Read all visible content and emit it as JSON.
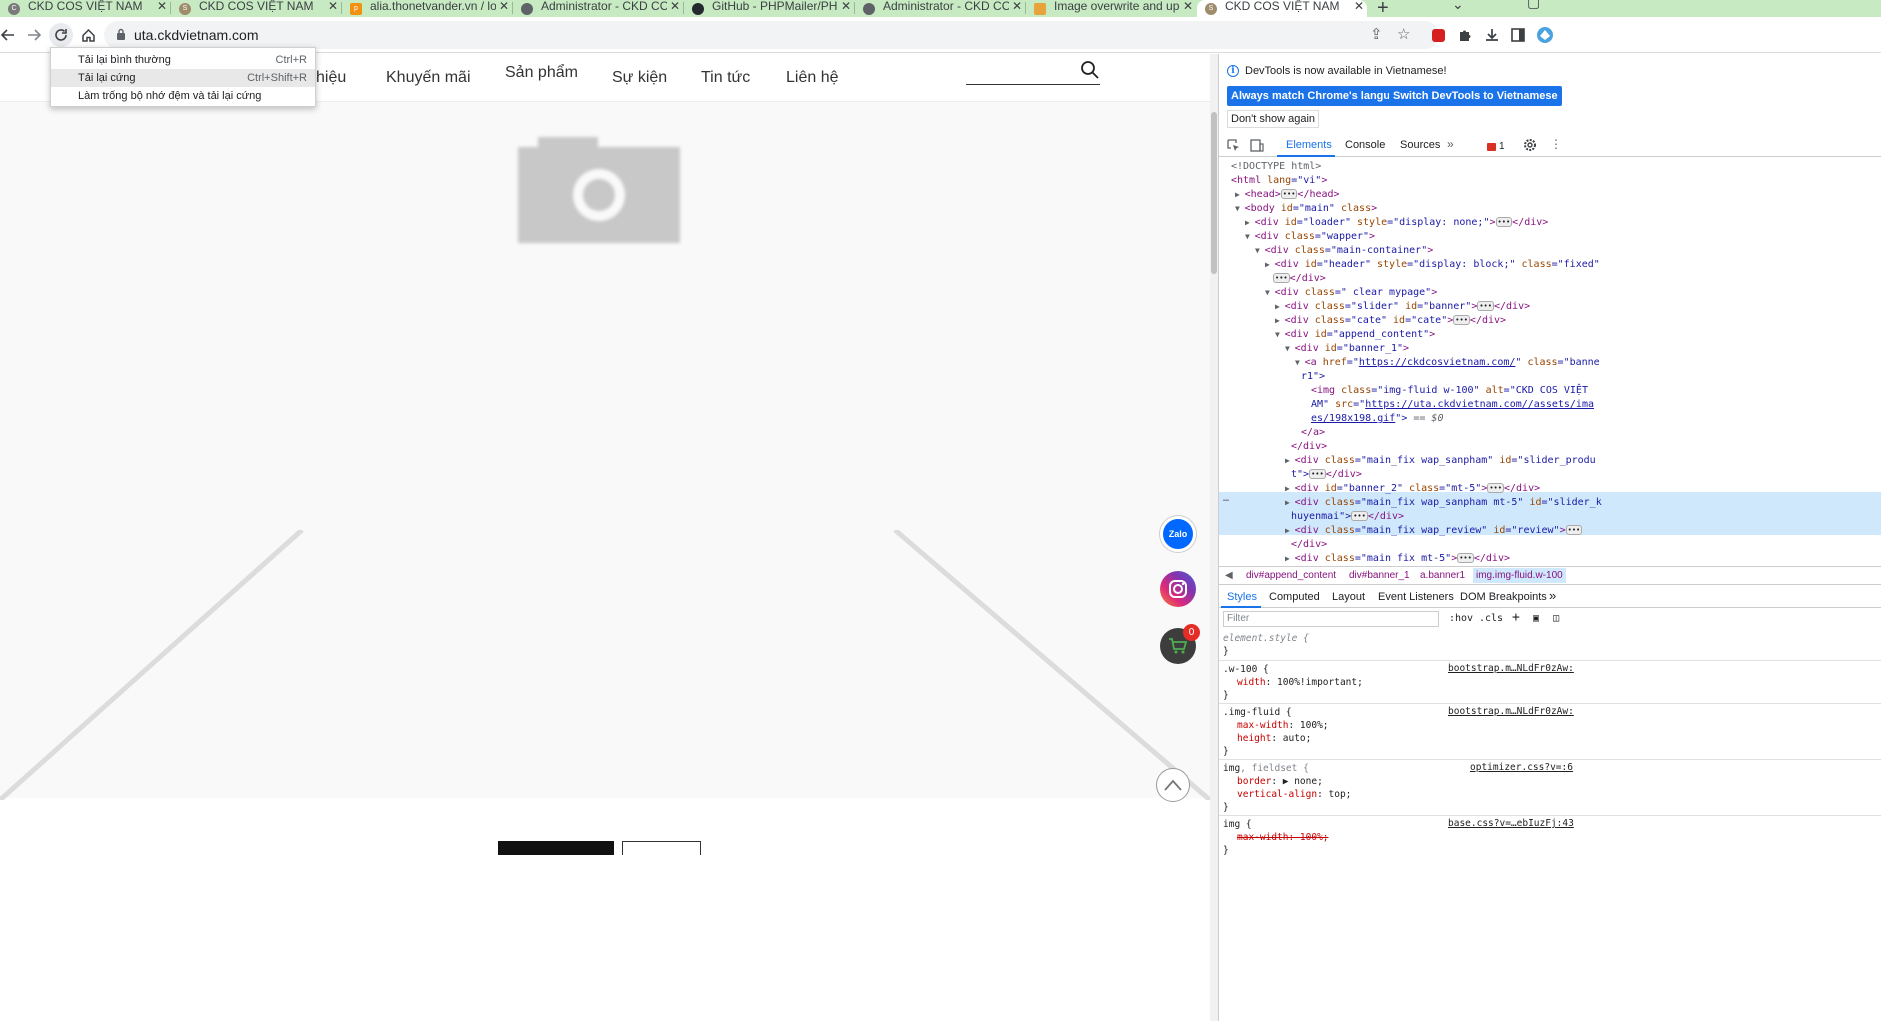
{
  "browser": {
    "tabs": [
      {
        "title": "CKD COS VIỆT NAM",
        "favicon_color": "#7a7a7a"
      },
      {
        "title": "CKD COS VIỆT NAM",
        "favicon_color": "#9e8c6a"
      },
      {
        "title": "alia.thonetvander.vn / loc",
        "favicon_color": "#f29111"
      },
      {
        "title": "Administrator - CKD COS",
        "favicon_color": "#5f6368"
      },
      {
        "title": "GitHub - PHPMailer/PHPI",
        "favicon_color": "#24292f"
      },
      {
        "title": "Administrator - CKD COS",
        "favicon_color": "#5f6368"
      },
      {
        "title": "Image overwrite and upd",
        "favicon_color": "#e8a33d"
      },
      {
        "title": "CKD COS VIỆT NAM",
        "favicon_color": "#9e8c6a"
      }
    ],
    "tab_close": "✕",
    "new_tab": "+",
    "url": "uta.ckdvietnam.com"
  },
  "reload_menu": {
    "items": [
      {
        "label": "Tải lại bình thường",
        "shortcut": "Ctrl+R"
      },
      {
        "label": "Tải lại cứng",
        "shortcut": "Ctrl+Shift+R"
      },
      {
        "label": "Làm trống bộ nhớ đệm và tải lại cứng",
        "shortcut": ""
      }
    ]
  },
  "site": {
    "nav": [
      "hiệu",
      "Khuyến mãi",
      "Sản phẩm",
      "Sự kiện",
      "Tin tức",
      "Liên hệ"
    ],
    "zalo_label": "Zalo",
    "cart_count": "0"
  },
  "devtools": {
    "info_text": "DevTools is now available in Vietnamese!",
    "btn_match": "Always match Chrome's language",
    "btn_switch": "Switch DevTools to Vietnamese",
    "btn_dont": "Don't show again",
    "tabs": [
      "Elements",
      "Console",
      "Sources"
    ],
    "error_count": "1",
    "breadcrumbs": [
      "div#append_content",
      "div#banner_1",
      "a.banner1",
      "img.img-fluid.w-100"
    ],
    "styles_tabs": [
      "Styles",
      "Computed",
      "Layout",
      "Event Listeners",
      "DOM Breakpoints"
    ],
    "filter_placeholder": "Filter",
    "hov": ":hov",
    "cls": ".cls",
    "dom_lines": {
      "l1": "<!DOCTYPE html>",
      "l2a": "<html ",
      "l2b": "lang",
      "l2c": "=\"vi\"",
      "l2d": ">",
      "l3": "<head>",
      "l3b": "</head>",
      "l4a": "<body ",
      "l4b": "id",
      "l4c": "=\"main\" ",
      "l4d": "class",
      "l4e": ">",
      "l5a": "<div ",
      "l5b": "id",
      "l5c": "=\"loader\" ",
      "l5d": "style",
      "l5e": "=\"display: none;\"",
      "l5f": ">",
      "l5g": "</div>",
      "l6a": "<div ",
      "l6b": "class",
      "l6c": "=\"wapper\"",
      "l6d": ">",
      "l7a": "<div ",
      "l7b": "class",
      "l7c": "=\"main-container\"",
      "l7d": ">",
      "l8a": "<div ",
      "l8b": "id",
      "l8c": "=\"header\" ",
      "l8d": "style",
      "l8e": "=\"display: block;\" ",
      "l8f": "class",
      "l8g": "=\"fixed\"",
      "l9": "</div>",
      "l10a": "<div ",
      "l10b": "class",
      "l10c": "=\" clear mypage\"",
      "l10d": ">",
      "l11a": "<div ",
      "l11b": "class",
      "l11c": "=\"slider\" ",
      "l11d": "id",
      "l11e": "=\"banner\"",
      "l11f": ">",
      "l11g": "</div>",
      "l12a": "<div ",
      "l12b": "class",
      "l12c": "=\"cate\" ",
      "l12d": "id",
      "l12e": "=\"cate\"",
      "l12f": ">",
      "l12g": "</div>",
      "l13a": "<div ",
      "l13b": "id",
      "l13c": "=\"append_content\"",
      "l13d": ">",
      "l14a": "<div ",
      "l14b": "id",
      "l14c": "=\"banner_1\"",
      "l14d": ">",
      "l15a": "<a ",
      "l15b": "href",
      "l15c": "=\"",
      "l15d": "https://ckdcosvietnam.com/",
      "l15e": "\" ",
      "l15f": "class",
      "l15g": "=\"banne",
      "l16": "r1\">",
      "l17a": "<img ",
      "l17b": "class",
      "l17c": "=\"img-fluid w-100\" ",
      "l17d": "alt",
      "l17e": "=\"CKD COS VIỆT",
      "l18a": "AM\" ",
      "l18b": "src",
      "l18c": "=\"",
      "l18d": "https://uta.ckdvietnam.com//assets/ima",
      "l19a": "es/198x198.gif",
      "l19b": "\">",
      "l19c": " == $0",
      "l20": "</a>",
      "l21": "</div>",
      "l22a": "<div ",
      "l22b": "class",
      "l22c": "=\"main_fix wap_sanpham\" ",
      "l22d": "id",
      "l22e": "=\"slider_produ",
      "l23a": "t\">",
      "l23b": "</div>",
      "l24a": "<div ",
      "l24b": "id",
      "l24c": "=\"banner_2\" ",
      "l24d": "class",
      "l24e": "=\"mt-5\"",
      "l24f": ">",
      "l24g": "</div>",
      "l25a": "<div ",
      "l25b": "class",
      "l25c": "=\"main_fix wap_sanpham mt-5\" ",
      "l25d": "id",
      "l25e": "=\"slider_k",
      "l26a": "huyenmai\">",
      "l26b": "</div>",
      "l27a": "<div ",
      "l27b": "class",
      "l27c": "=\"main_fix wap_review\" ",
      "l27d": "id",
      "l27e": "=\"review\"",
      "l27f": ">",
      "l28": "</div>",
      "l29a": "<div ",
      "l29b": "class",
      "l29c": "=\"main fix mt-5\"",
      "l29d": ">",
      "l29e": "</div>"
    },
    "styles": {
      "r0_sel": "element.style {",
      "r0_end": "}",
      "r1_sel": ".w-100 {",
      "r1_src": "bootstrap.m…NLdFr0zAw:",
      "r1_p1": "width",
      "r1_v1": ": 100%!important;",
      "r1_end": "}",
      "r2_sel": ".img-fluid {",
      "r2_src": "bootstrap.m…NLdFr0zAw:",
      "r2_p1": "max-width",
      "r2_v1": ": 100%;",
      "r2_p2": "height",
      "r2_v2": ": auto;",
      "r2_end": "}",
      "r3_sel_a": "img",
      "r3_sel_b": ", fieldset {",
      "r3_src": "optimizer.css?v=:6",
      "r3_p1": "border",
      "r3_v1": ": ▶ none;",
      "r3_p2": "vertical-align",
      "r3_v2": ": top;",
      "r3_end": "}",
      "r4_sel": "img {",
      "r4_src": "base.css?v=…ebIuzFj:43",
      "r4_p1": "max-width: 100%;",
      "r4_end": "}"
    }
  },
  "colors": {
    "tabstrip": "#c7eac3",
    "devtools_accent": "#1a73e8",
    "selected_node": "#cfe8fc"
  }
}
